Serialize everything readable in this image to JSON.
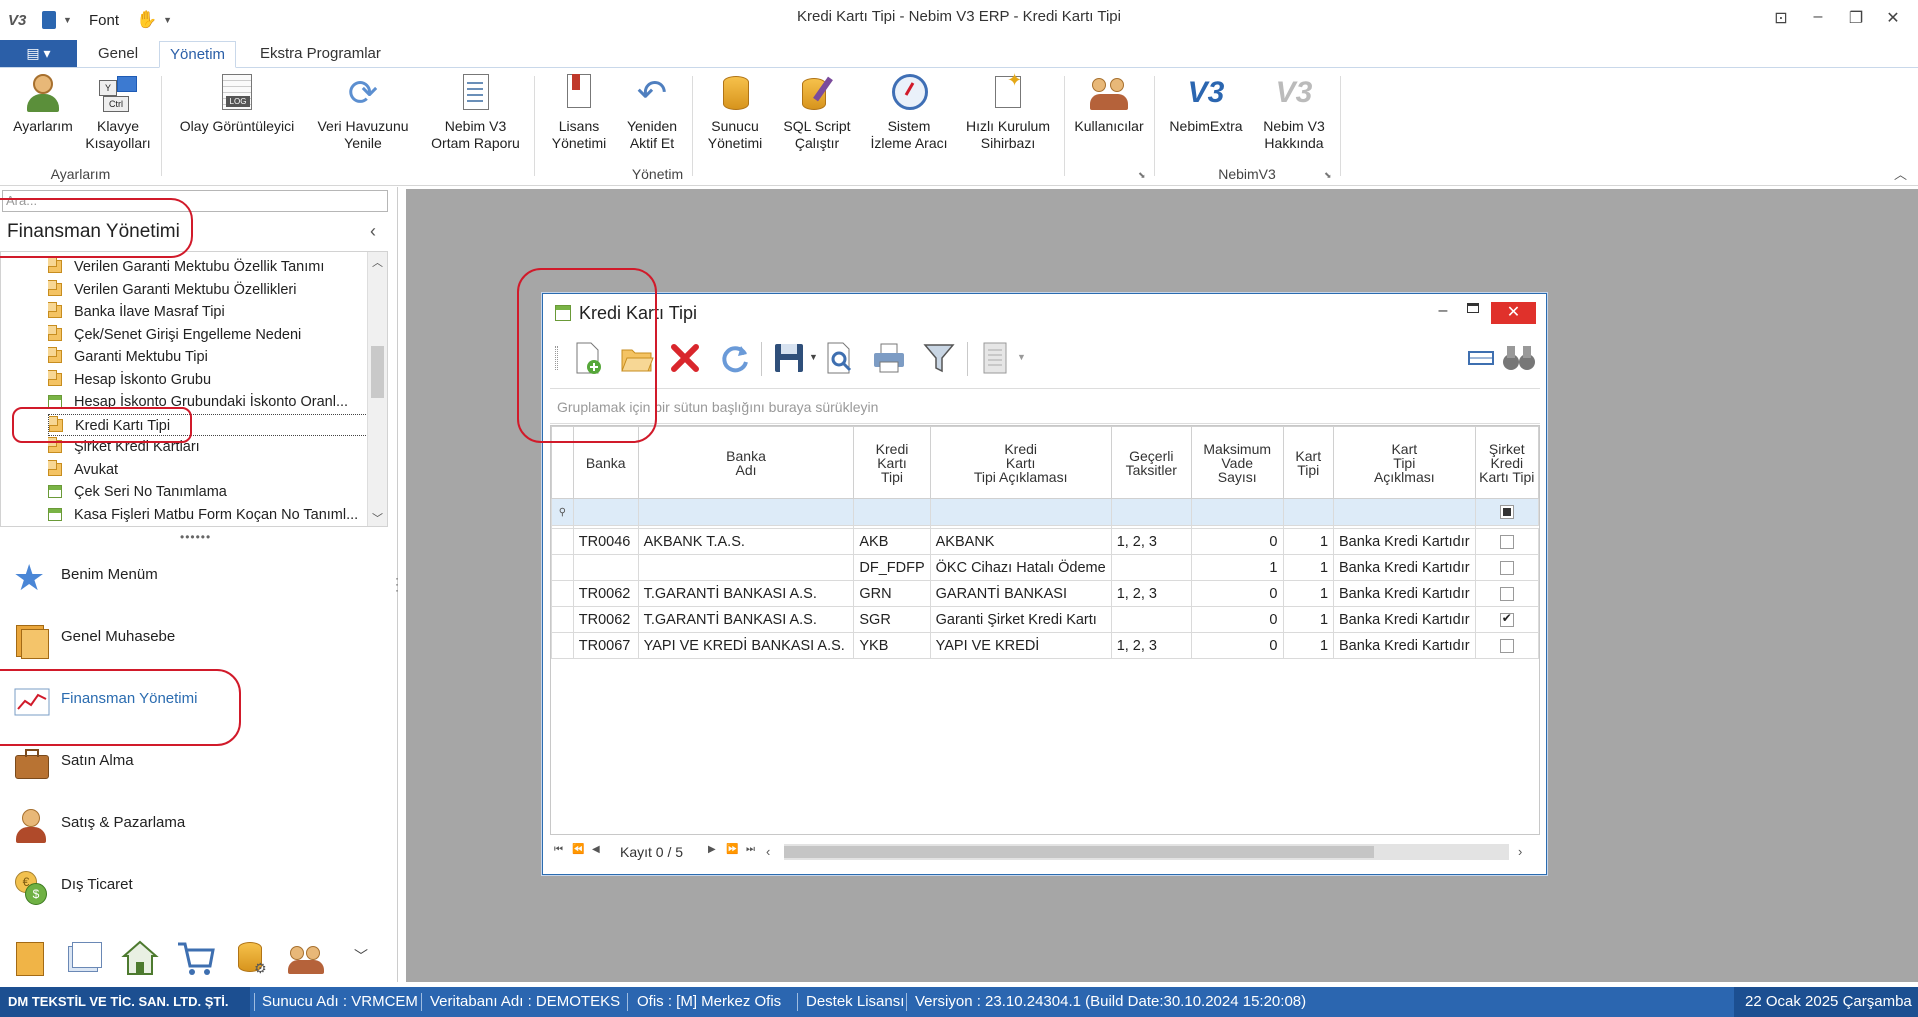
{
  "window": {
    "title": "Kredi Kartı Tipi - Nebim V3 ERP - Kredi Kartı Tipi",
    "quick_access": {
      "app_icon": "V3",
      "font_label": "Font"
    }
  },
  "tabs": {
    "file_icon": "menu-icon",
    "items": [
      {
        "label": "Genel"
      },
      {
        "label": "Yönetim"
      },
      {
        "label": "Ekstra Programlar"
      }
    ]
  },
  "ribbon": {
    "buttons": {
      "ayarlarim": {
        "l1": "Ayarlarım",
        "l2": ""
      },
      "klavye": {
        "l1": "Klavye",
        "l2": "Kısayolları"
      },
      "olay": {
        "l1": "Olay Görüntüleyici",
        "l2": ""
      },
      "veri": {
        "l1": "Veri Havuzunu",
        "l2": "Yenile"
      },
      "nebim_rapor": {
        "l1": "Nebim V3",
        "l2": "Ortam Raporu"
      },
      "lisans": {
        "l1": "Lisans",
        "l2": "Yönetimi"
      },
      "yeniden": {
        "l1": "Yeniden",
        "l2": "Aktif Et"
      },
      "sunucu": {
        "l1": "Sunucu",
        "l2": "Yönetimi"
      },
      "sql": {
        "l1": "SQL Script",
        "l2": "Çalıştır"
      },
      "sistem": {
        "l1": "Sistem",
        "l2": "İzleme Aracı"
      },
      "hizli": {
        "l1": "Hızlı Kurulum",
        "l2": "Sihirbazı"
      },
      "kullanicilar": {
        "l1": "Kullanıcılar",
        "l2": ""
      },
      "nebimextra": {
        "l1": "NebimExtra",
        "l2": ""
      },
      "hakkinda": {
        "l1": "Nebim V3",
        "l2": "Hakkında"
      }
    },
    "groups": {
      "ayarlarim": "Ayarlarım",
      "yonetim": "Yönetim",
      "nebimv3": "NebimV3"
    },
    "small_icons": {
      "log": "LOG",
      "v3": "V3",
      "klavye_y": "Y",
      "klavye_ctrl": "Ctrl"
    }
  },
  "sidebar": {
    "search_placeholder": "Ara...",
    "module_title": "Finansman Yönetimi",
    "tree": [
      {
        "label": "Verilen Garanti Mektubu Özellik Tanımı",
        "icon": "folder"
      },
      {
        "label": "Verilen Garanti Mektubu Özellikleri",
        "icon": "folder"
      },
      {
        "label": "Banka İlave Masraf Tipi",
        "icon": "folder"
      },
      {
        "label": "Çek/Senet Girişi Engelleme Nedeni",
        "icon": "folder"
      },
      {
        "label": "Garanti Mektubu Tipi",
        "icon": "folder"
      },
      {
        "label": "Hesap İskonto Grubu",
        "icon": "folder"
      },
      {
        "label": "Hesap İskonto Grubundaki İskonto Oranl...",
        "icon": "form"
      },
      {
        "label": "Kredi Kartı Tipi",
        "icon": "folder"
      },
      {
        "label": "Şirket Kredi Kartları",
        "icon": "folder"
      },
      {
        "label": "Avukat",
        "icon": "folder"
      },
      {
        "label": "Çek Seri No Tanımlama",
        "icon": "form"
      },
      {
        "label": "Kasa Fişleri Matbu Form Koçan No Tanıml...",
        "icon": "form"
      }
    ],
    "nav": [
      {
        "label": "Benim Menüm",
        "icon": "star-icon"
      },
      {
        "label": "Genel Muhasebe",
        "icon": "ledger-icon"
      },
      {
        "label": "Finansman Yönetimi",
        "icon": "chart-icon"
      },
      {
        "label": "Satın Alma",
        "icon": "briefcase-icon"
      },
      {
        "label": "Satış & Pazarlama",
        "icon": "salesperson-icon"
      },
      {
        "label": "Dış Ticaret",
        "icon": "currency-icon"
      }
    ]
  },
  "child": {
    "title": "Kredi Kartı Tipi",
    "group_hint": "Gruplamak için bir sütun başlığını buraya sürükleyin",
    "columns": [
      [
        "Banka"
      ],
      [
        "Banka",
        "Adı"
      ],
      [
        "Kredi",
        "Kartı",
        "Tipi"
      ],
      [
        "Kredi",
        "Kartı",
        "Tipi Açıklaması"
      ],
      [
        "Geçerli",
        "Taksitler"
      ],
      [
        "Maksimum",
        "Vade",
        "Sayısı"
      ],
      [
        "Kart",
        "Tipi"
      ],
      [
        "Kart",
        "Tipi",
        "Açıklması"
      ],
      [
        "Şirket",
        "Kredi",
        "Kartı Tipi"
      ]
    ],
    "rows": [
      {
        "banka": "TR0046",
        "adi": "AKBANK T.A.S.",
        "kod": "AKB",
        "aciklama": "AKBANK",
        "taksit": "1, 2, 3",
        "vade": "0",
        "tip": "1",
        "tipaciklama": "Banka Kredi Kartıdır",
        "sirket": false
      },
      {
        "banka": "",
        "adi": "",
        "kod": "DF_FDFP",
        "aciklama": "ÖKC Cihazı Hatalı Ödeme",
        "taksit": "",
        "vade": "1",
        "tip": "1",
        "tipaciklama": "Banka Kredi Kartıdır",
        "sirket": false
      },
      {
        "banka": "TR0062",
        "adi": "T.GARANTİ BANKASI A.S.",
        "kod": "GRN",
        "aciklama": "GARANTİ BANKASI",
        "taksit": "1, 2, 3",
        "vade": "0",
        "tip": "1",
        "tipaciklama": "Banka Kredi Kartıdır",
        "sirket": false
      },
      {
        "banka": "TR0062",
        "adi": "T.GARANTİ BANKASI A.S.",
        "kod": "SGR",
        "aciklama": "Garanti Şirket Kredi Kartı",
        "taksit": "",
        "vade": "0",
        "tip": "1",
        "tipaciklama": "Banka Kredi Kartıdır",
        "sirket": true
      },
      {
        "banka": "TR0067",
        "adi": "YAPI VE KREDİ BANKASI A.S.",
        "kod": "YKB",
        "aciklama": "YAPI VE KREDİ",
        "taksit": "1, 2, 3",
        "vade": "0",
        "tip": "1",
        "tipaciklama": "Banka Kredi Kartıdır",
        "sirket": false
      }
    ],
    "record": "Kayıt 0 / 5"
  },
  "status": {
    "company": "DM TEKSTİL VE TİC. SAN. LTD. ŞTİ.",
    "server": "Sunucu Adı : VRMCEM",
    "db": "Veritabanı Adı : DEMOTEKS",
    "office": "Ofis : [M]  Merkez Ofis",
    "license": "Destek Lisansı",
    "version": "Versiyon : 23.10.24304.1 (Build Date:30.10.2024 15:20:08)",
    "date": "22 Ocak 2025 Çarşamba"
  },
  "colors": {
    "accent": "#2b66b0",
    "annotation": "#d11a2a",
    "workspace": "#a6a6a6"
  }
}
